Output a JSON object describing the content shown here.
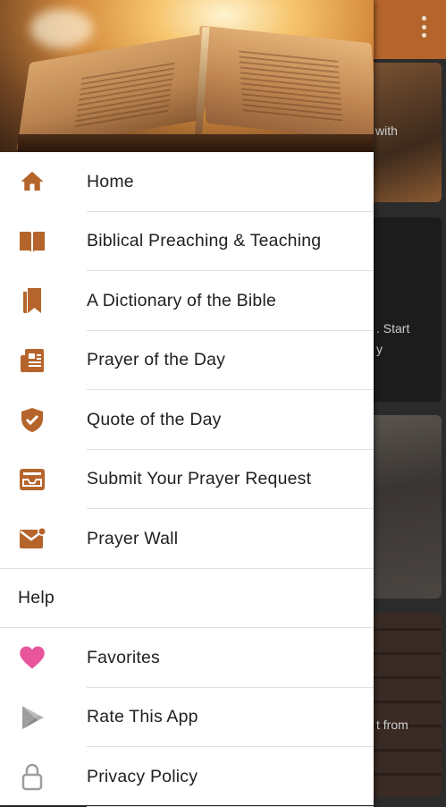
{
  "colors": {
    "accent": "#b5652b",
    "heart": "#e8559b",
    "grey_icon": "#9e9e9e"
  },
  "background": {
    "card_snippets": [
      "with",
      ". Start",
      "y",
      "t from"
    ]
  },
  "drawer": {
    "menu": [
      {
        "label": "Home",
        "icon": "home-icon"
      },
      {
        "label": "Biblical Preaching & Teaching",
        "icon": "open-book-icon"
      },
      {
        "label": "A Dictionary of the Bible",
        "icon": "bookmark-book-icon"
      },
      {
        "label": "Prayer of the Day",
        "icon": "newspaper-icon"
      },
      {
        "label": "Quote of the Day",
        "icon": "shield-check-icon"
      },
      {
        "label": "Submit Your Prayer Request",
        "icon": "inbox-tray-icon"
      },
      {
        "label": "Prayer Wall",
        "icon": "mail-badge-icon"
      }
    ],
    "section_title": "Help",
    "help_menu": [
      {
        "label": "Favorites",
        "icon": "heart-icon"
      },
      {
        "label": "Rate This App",
        "icon": "play-store-icon"
      },
      {
        "label": "Privacy Policy",
        "icon": "lock-icon"
      }
    ]
  }
}
